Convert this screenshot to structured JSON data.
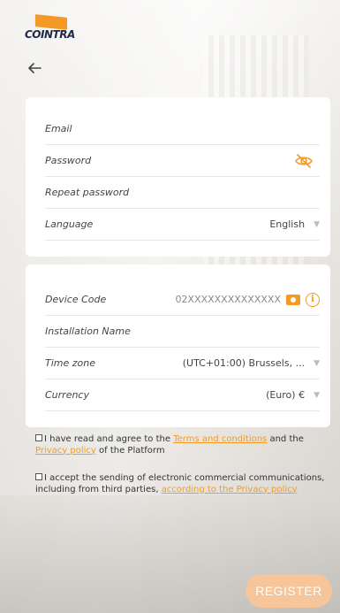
{
  "brand": {
    "name": "COINTRA"
  },
  "account": {
    "email_label": "Email",
    "password_label": "Password",
    "repeat_password_label": "Repeat password",
    "language_label": "Language",
    "language_value": "English"
  },
  "installation": {
    "device_code_label": "Device Code",
    "device_code_value": "02XXXXXXXXXXXXXX",
    "installation_name_label": "Installation Name",
    "time_zone_label": "Time zone",
    "time_zone_value": "(UTC+01:00) Brussels, ...",
    "currency_label": "Currency",
    "currency_value": "(Euro) €"
  },
  "consents": {
    "terms_prefix": "I have read and agree to the ",
    "terms_link": "Terms and conditions",
    "terms_middle": " and the ",
    "privacy_link": "Privacy policy",
    "terms_suffix": " of the Platform",
    "marketing_text": "I accept the sending of electronic commercial communications, including from third parties, ",
    "marketing_link": "according to the Privacy policy"
  },
  "actions": {
    "register_label": "REGISTER"
  },
  "colors": {
    "accent": "#f39a26",
    "register_bg": "#f7c59a"
  },
  "icons": {
    "back": "arrow-left-icon",
    "password_toggle": "eye-off-icon",
    "camera": "camera-icon",
    "info": "info-icon",
    "dropdown": "caret-down-icon"
  }
}
